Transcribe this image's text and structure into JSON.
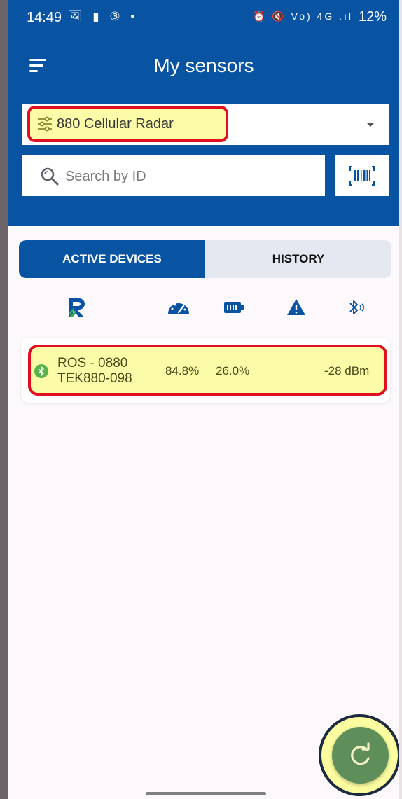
{
  "status_bar": {
    "time": "14:49",
    "left_icons": "🖼 ▮ ③ •",
    "right_icons": "⏰ 🔇 Vo) 4G .ıl",
    "battery": "12%"
  },
  "header": {
    "title": "My sensors",
    "menu_icon": "menu-icon"
  },
  "dropdown": {
    "selected": "880 Cellular Radar",
    "icon": "filter-icon"
  },
  "search": {
    "placeholder": "Search by ID",
    "value": ""
  },
  "scan_button": {
    "icon": "barcode-scan-icon"
  },
  "tabs": [
    {
      "label": "ACTIVE DEVICES",
      "active": true
    },
    {
      "label": "HISTORY",
      "active": false
    }
  ],
  "columns": [
    {
      "icon": "brand-r-icon"
    },
    {
      "icon": "speedometer-icon"
    },
    {
      "icon": "battery-icon"
    },
    {
      "icon": "warning-icon"
    },
    {
      "icon": "bluetooth-signal-icon"
    }
  ],
  "devices": [
    {
      "name": "ROS - 0880",
      "id": "TEK880-098",
      "level": "84.8%",
      "battery": "26.0%",
      "alert": "",
      "signal": "-28 dBm",
      "connection_icon": "bluetooth-icon"
    }
  ],
  "fab": {
    "icon": "refresh-icon"
  },
  "colors": {
    "primary": "#0953a3",
    "highlight": "#fcfca8",
    "highlight_border": "#e10f1f",
    "fab": "#5e8f5b",
    "bluetooth_badge": "#5ab24b"
  }
}
